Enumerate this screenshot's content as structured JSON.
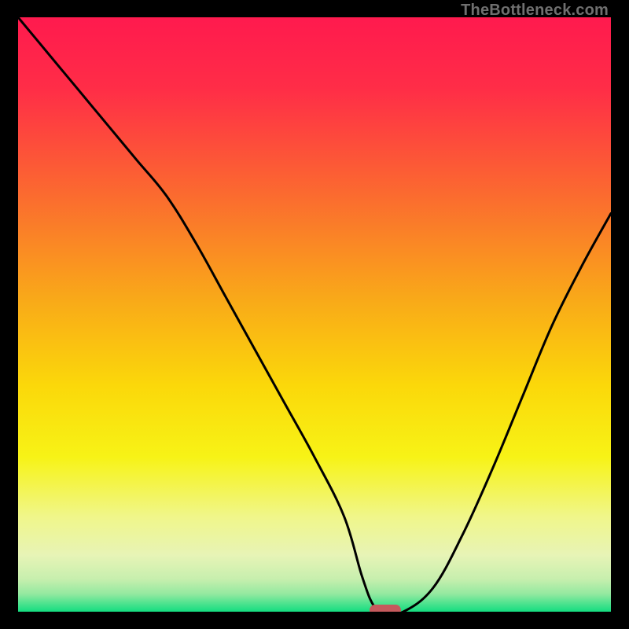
{
  "watermark": "TheBottleneck.com",
  "chart_data": {
    "type": "line",
    "title": "",
    "xlabel": "",
    "ylabel": "",
    "xlim": [
      0,
      100
    ],
    "ylim": [
      0,
      100
    ],
    "x": [
      0,
      5,
      10,
      15,
      20,
      25,
      30,
      35,
      40,
      45,
      50,
      55,
      58,
      60,
      62,
      65,
      70,
      75,
      80,
      85,
      90,
      95,
      100
    ],
    "values": [
      100,
      94,
      88,
      82,
      76,
      70,
      62,
      53,
      44,
      35,
      26,
      16,
      6,
      1,
      0,
      0,
      4,
      13,
      24,
      36,
      48,
      58,
      67
    ],
    "gradient_stops": [
      {
        "pos": 0.0,
        "color": "#ff1a4e"
      },
      {
        "pos": 0.12,
        "color": "#ff2d47"
      },
      {
        "pos": 0.3,
        "color": "#fb6b2f"
      },
      {
        "pos": 0.48,
        "color": "#f9ab18"
      },
      {
        "pos": 0.62,
        "color": "#fbd80a"
      },
      {
        "pos": 0.74,
        "color": "#f7f316"
      },
      {
        "pos": 0.84,
        "color": "#f0f68a"
      },
      {
        "pos": 0.905,
        "color": "#e7f4b6"
      },
      {
        "pos": 0.945,
        "color": "#c7efae"
      },
      {
        "pos": 0.97,
        "color": "#94e9a0"
      },
      {
        "pos": 0.986,
        "color": "#4ee38f"
      },
      {
        "pos": 1.0,
        "color": "#14dd80"
      }
    ],
    "marker": {
      "x": 62,
      "y": 0
    },
    "marker_color": "#c65a5d",
    "line_color": "#000000"
  }
}
